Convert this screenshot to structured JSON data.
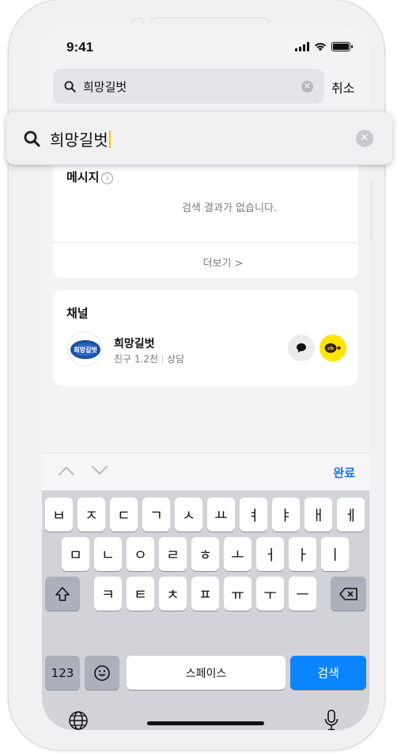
{
  "status": {
    "time": "9:41"
  },
  "search": {
    "query": "희망길벗",
    "cancel_label": "취소"
  },
  "messages": {
    "title": "메시지",
    "empty_text": "검색 결과가 없습니다.",
    "more_label": "더보기 >"
  },
  "channels": {
    "title": "채널",
    "item": {
      "name": "희망길벗",
      "friends": "친구 1.2천",
      "category": "상담",
      "logo_text": "희망길벗"
    }
  },
  "keyboard": {
    "done_label": "완료",
    "row1": [
      "ㅂ",
      "ㅈ",
      "ㄷ",
      "ㄱ",
      "ㅅ",
      "ㅛ",
      "ㅕ",
      "ㅑ",
      "ㅐ",
      "ㅔ"
    ],
    "row2": [
      "ㅁ",
      "ㄴ",
      "ㅇ",
      "ㄹ",
      "ㅎ",
      "ㅗ",
      "ㅓ",
      "ㅏ",
      "ㅣ"
    ],
    "row3": [
      "ㅋ",
      "ㅌ",
      "ㅊ",
      "ㅍ",
      "ㅠ",
      "ㅜ",
      "ㅡ"
    ],
    "num_label": "123",
    "space_label": "스페이스",
    "search_label": "검색"
  },
  "colors": {
    "accent": "#1a73e8",
    "kakao_yellow": "#fee500",
    "search_key": "#0a84ff"
  }
}
